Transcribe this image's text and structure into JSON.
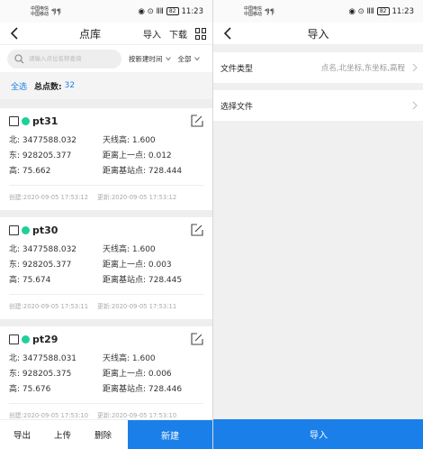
{
  "status_bar": {
    "carrier_top": "中国电信",
    "carrier_bottom": "中国移动",
    "signal": "⁴ˡ|l ⁴ˡ|l",
    "right_icons": "◉ ⊙ ⅡⅡ",
    "battery": "82",
    "time": "11:23"
  },
  "left": {
    "title": "点库",
    "actions": {
      "import": "导入",
      "download": "下载"
    },
    "search": {
      "placeholder": "请输入点位名称查询"
    },
    "sort_label": "按新建时间",
    "filter_label": "全部",
    "summary": {
      "select_all": "全选",
      "count_label": "总点数:",
      "count_value": "32"
    },
    "cards": [
      {
        "name": "pt31",
        "north": "北: 3477588.032",
        "antenna": "天线高: 1.600",
        "east": "东: 928205.377",
        "dist_prev": "距离上一点: 0.012",
        "height": "高: 75.662",
        "dist_base": "距离基站点: 728.444",
        "created": "创建:2020-09-05 17:53:12",
        "updated": "更新:2020-09-05 17:53:12"
      },
      {
        "name": "pt30",
        "north": "北: 3477588.032",
        "antenna": "天线高: 1.600",
        "east": "东: 928205.377",
        "dist_prev": "距离上一点: 0.003",
        "height": "高: 75.674",
        "dist_base": "距离基站点: 728.445",
        "created": "创建:2020-09-05 17:53:11",
        "updated": "更新:2020-09-05 17:53:11"
      },
      {
        "name": "pt29",
        "north": "北: 3477588.031",
        "antenna": "天线高: 1.600",
        "east": "东: 928205.375",
        "dist_prev": "距离上一点: 0.006",
        "height": "高: 75.676",
        "dist_base": "距离基站点: 728.446",
        "created": "创建:2020-09-05 17:53:10",
        "updated": "更新:2020-09-05 17:53:10"
      }
    ],
    "bottom": {
      "export": "导出",
      "upload": "上传",
      "delete": "删除",
      "new": "新建"
    }
  },
  "right": {
    "title": "导入",
    "file_type_label": "文件类型",
    "file_type_value": "点名,北坐标,东坐标,高程",
    "choose_file_label": "选择文件",
    "import_button": "导入"
  },
  "colors": {
    "accent": "#1a7fe8",
    "point_dot": "#1fcf9a"
  }
}
